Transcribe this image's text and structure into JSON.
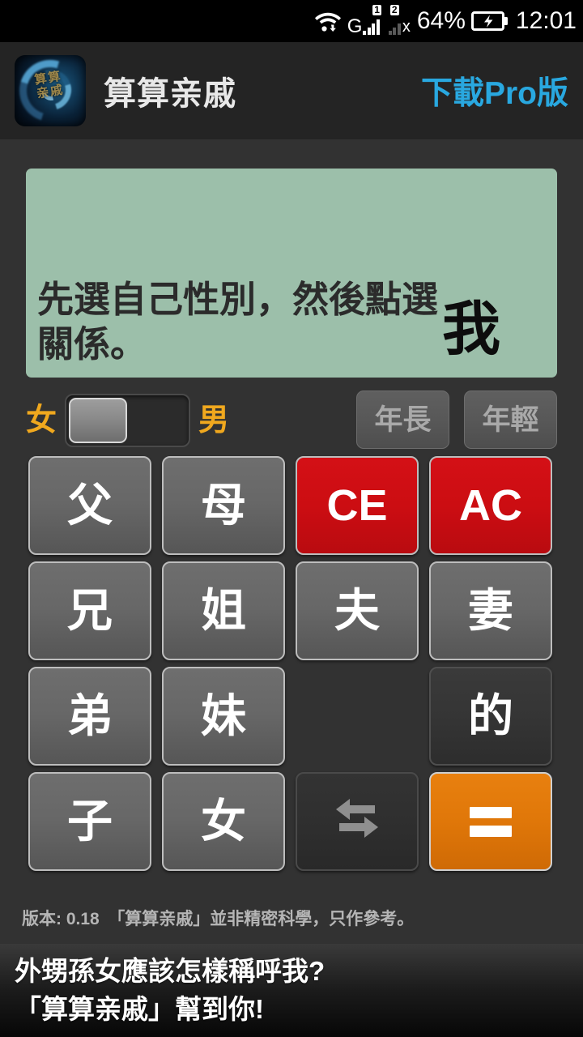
{
  "status_bar": {
    "wifi_icon": "wifi-icon",
    "sim1_label": "G",
    "sim1_badge": "1",
    "sim2_badge": "2",
    "sim2_x": "x",
    "battery_percent": "64%",
    "battery_icon": "battery-charging-icon",
    "time": "12:01"
  },
  "header": {
    "app_icon": "app-icon-swirl",
    "icon_glyphs": "算算\n亲戚",
    "title": "算算亲戚",
    "pro_link": "下載Pro版",
    "pro_link_color": "#29a8e0"
  },
  "display": {
    "expression": "先選自己性別，然後點選關係。",
    "result": "我",
    "background_color": "#9cbfaa"
  },
  "controls": {
    "gender_left_label": "女",
    "gender_right_label": "男",
    "gender_label_color": "#f0a81e",
    "toggle_state": "女",
    "age_buttons": [
      {
        "label": "年長",
        "name": "elder-button"
      },
      {
        "label": "年輕",
        "name": "younger-button"
      }
    ]
  },
  "keypad": {
    "keys": [
      {
        "label": "父",
        "name": "key-father",
        "style": "normal"
      },
      {
        "label": "母",
        "name": "key-mother",
        "style": "normal"
      },
      {
        "label": "CE",
        "name": "key-ce",
        "style": "red"
      },
      {
        "label": "AC",
        "name": "key-ac",
        "style": "red"
      },
      {
        "label": "兄",
        "name": "key-elder-brother",
        "style": "normal"
      },
      {
        "label": "姐",
        "name": "key-elder-sister",
        "style": "normal"
      },
      {
        "label": "夫",
        "name": "key-husband",
        "style": "normal"
      },
      {
        "label": "妻",
        "name": "key-wife",
        "style": "normal"
      },
      {
        "label": "弟",
        "name": "key-younger-brother",
        "style": "normal"
      },
      {
        "label": "妹",
        "name": "key-younger-sister",
        "style": "normal"
      },
      {
        "label": "",
        "name": "key-blank",
        "style": "blank"
      },
      {
        "label": "的",
        "name": "key-possessive",
        "style": "dark"
      },
      {
        "label": "子",
        "name": "key-son",
        "style": "normal"
      },
      {
        "label": "女",
        "name": "key-daughter",
        "style": "normal"
      },
      {
        "label": "",
        "name": "key-swap",
        "style": "swap",
        "icon": "swap-arrows-icon"
      },
      {
        "label": "",
        "name": "key-equals",
        "style": "orange",
        "icon": "equals-icon"
      }
    ],
    "accent_red": "#cc0d12",
    "accent_orange": "#e07709"
  },
  "footer": {
    "version_text": "版本: 0.18　「算算亲戚」並非精密科學，只作參考。"
  },
  "ad": {
    "line1": "外甥孫女應該怎樣稱呼我?",
    "line2": "「算算亲戚」幫到你!"
  }
}
